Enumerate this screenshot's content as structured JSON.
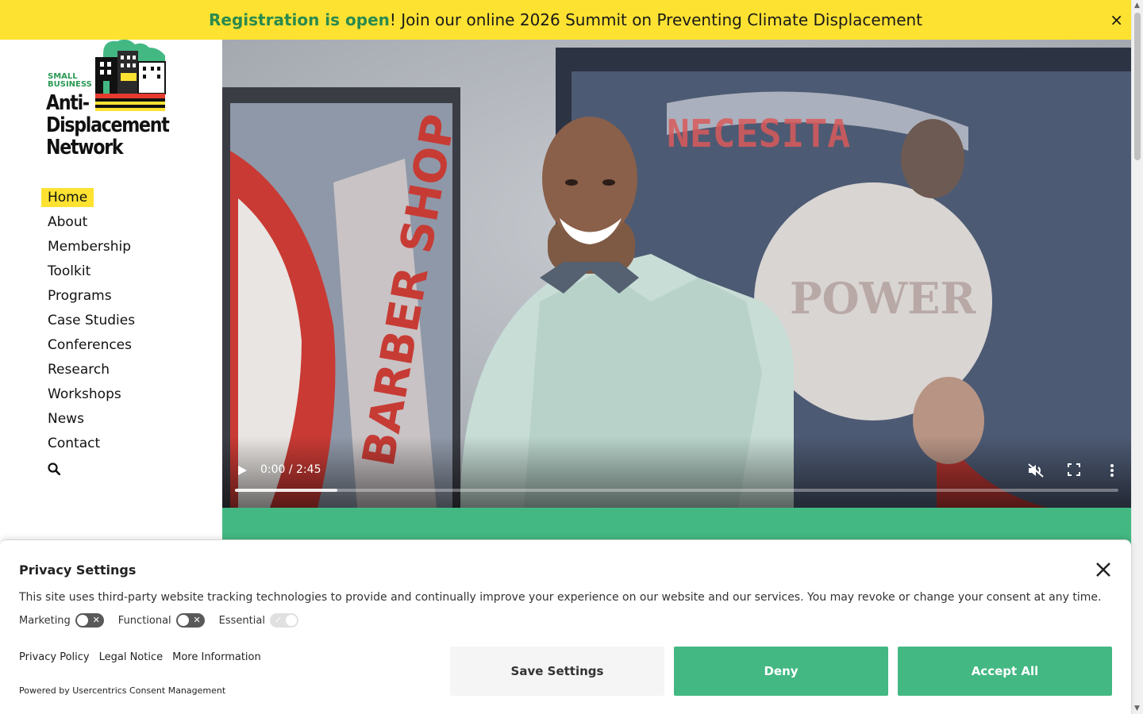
{
  "banner": {
    "highlight": "Registration is open",
    "text": "! Join our online 2026 Summit on Preventing Climate Displacement",
    "close_label": "×"
  },
  "logo": {
    "small_business": "SMALL\nBUSINESS",
    "name": "Anti-\nDisplacement\nNetwork"
  },
  "nav": {
    "items": [
      {
        "label": "Home"
      },
      {
        "label": "About"
      },
      {
        "label": "Membership"
      },
      {
        "label": "Toolkit"
      },
      {
        "label": "Programs"
      },
      {
        "label": "Case Studies"
      },
      {
        "label": "Conferences"
      },
      {
        "label": "Research"
      },
      {
        "label": "Workshops"
      },
      {
        "label": "News"
      },
      {
        "label": "Contact"
      }
    ],
    "search_icon": "search-icon"
  },
  "video": {
    "time": "0:00 / 2:45",
    "progress": 0.116,
    "muted": true
  },
  "privacy": {
    "title": "Privacy Settings",
    "description": "This site uses third-party website tracking technologies to provide and continually improve your experience on our website and our services. You may revoke or change your consent at any time.",
    "toggles": [
      {
        "label": "Marketing",
        "state": "off"
      },
      {
        "label": "Functional",
        "state": "off"
      },
      {
        "label": "Essential",
        "state": "on-disabled"
      }
    ],
    "links": [
      "Privacy Policy",
      "Legal Notice",
      "More Information"
    ],
    "powered_by": "Powered by Usercentrics Consent Management",
    "buttons": {
      "save": "Save Settings",
      "deny": "Deny",
      "accept": "Accept All"
    }
  },
  "colors": {
    "banner_bg": "#fde232",
    "brand_green": "#43b883",
    "highlight_green": "#2a8a4f"
  }
}
